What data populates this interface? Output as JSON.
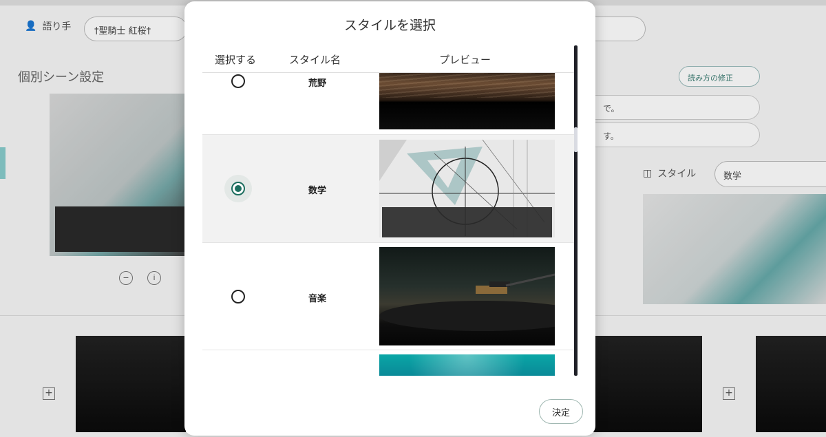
{
  "background": {
    "narrator_label": "語り手",
    "narrator_value": "†聖騎士 紅桜†",
    "section_title": "個別シーン設定",
    "read_fix_button": "読み方の修正",
    "field_1": "で。",
    "field_2": "す。",
    "style_label": "スタイル",
    "style_value": "数学"
  },
  "modal": {
    "title": "スタイルを選択",
    "columns": {
      "select": "選択する",
      "name": "スタイル名",
      "preview": "プレビュー"
    },
    "rows": [
      {
        "name": "荒野",
        "selected": false
      },
      {
        "name": "数学",
        "selected": true
      },
      {
        "name": "音楽",
        "selected": false
      },
      {
        "name": "",
        "selected": false
      }
    ],
    "confirm_button": "決定"
  },
  "colors": {
    "accent": "#1d6e5f",
    "scrollbar": "#1f2027"
  }
}
